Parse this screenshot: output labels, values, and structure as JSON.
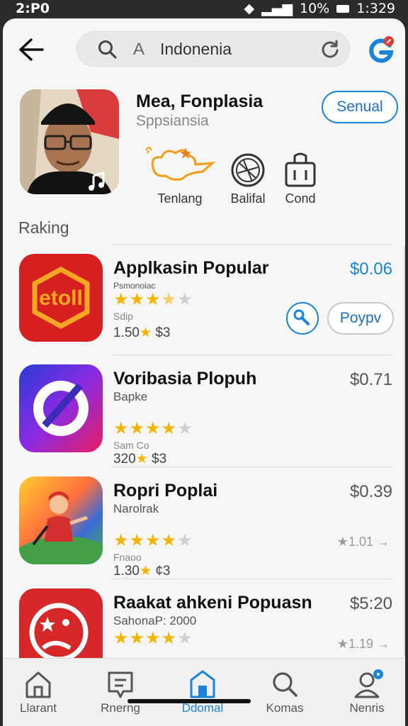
{
  "status_bar": {
    "time_left": "2:P0",
    "battery": "10%",
    "time_right": "1:329"
  },
  "search": {
    "query": "Indonenia",
    "glyph": "A"
  },
  "profile": {
    "name": "Mea, Fonplasia",
    "subtitle": "Sppsiansia",
    "button_label": "Senual"
  },
  "chips": [
    {
      "label": "Tenlang",
      "icon": "map-icon"
    },
    {
      "label": "Balifal",
      "icon": "globe-icon"
    },
    {
      "label": "Cond",
      "icon": "luggage-icon"
    }
  ],
  "section_title": "Raking",
  "apps": [
    {
      "title": "Applkasin Popular",
      "subtitle": "Psmonoiac",
      "rating_stars": 3.5,
      "sub2": "Sdip",
      "meta_count": "1.50",
      "meta_price": "$3",
      "price": "$0.06",
      "price_color": "#1a84d8",
      "action_label": "Poypv",
      "icon": "etoll-app-icon"
    },
    {
      "title": "Voribasia Plopuh",
      "subtitle": "Bapke",
      "rating_stars": 4.5,
      "sub2": "Sam Co",
      "meta_count": "320",
      "meta_price": "$3",
      "price": "$0.71",
      "price_color": "#555555",
      "icon": "ring-app-icon"
    },
    {
      "title": "Ropri Poplai",
      "subtitle": "Narolrak",
      "rating_stars": 4.5,
      "sub2": "Fnaoo",
      "meta_count": "1.30",
      "meta_price": "¢3",
      "price": "$0.39",
      "price_color": "#555555",
      "trend": "1.01",
      "icon": "person-app-icon"
    },
    {
      "title": "Raakat ahkeni Popuasn",
      "subtitle": "SahonaP: 2000",
      "rating_stars": 4,
      "price": "$5:20",
      "price_color": "#555555",
      "trend": "1.19",
      "icon": "emblem-app-icon"
    }
  ],
  "bottom_nav": [
    {
      "label": "Llarant",
      "icon": "home-icon",
      "active": false
    },
    {
      "label": "Rnerng",
      "icon": "message-icon",
      "active": false
    },
    {
      "label": "Ddomal",
      "icon": "store-icon",
      "active": true
    },
    {
      "label": "Komas",
      "icon": "search-icon",
      "active": false
    },
    {
      "label": "Nenris",
      "icon": "account-icon",
      "active": false
    }
  ],
  "colors": {
    "accent": "#1a84d8",
    "star": "#f4b400",
    "background": "#f6f6f7"
  }
}
